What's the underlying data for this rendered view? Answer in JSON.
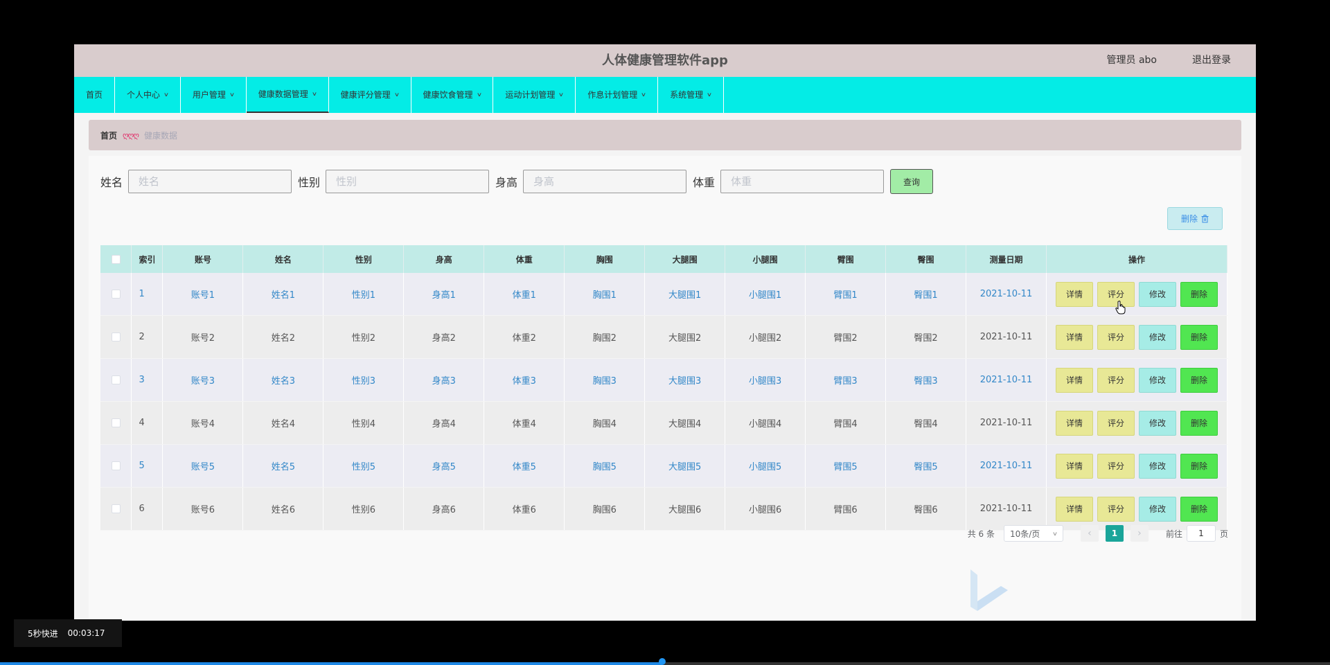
{
  "header": {
    "title": "人体健康管理软件app",
    "admin": "管理员 abo",
    "logout": "退出登录"
  },
  "nav": [
    {
      "label": "首页",
      "has_dropdown": false,
      "active": false
    },
    {
      "label": "个人中心",
      "has_dropdown": true,
      "active": false
    },
    {
      "label": "用户管理",
      "has_dropdown": true,
      "active": false
    },
    {
      "label": "健康数据管理",
      "has_dropdown": true,
      "active": true
    },
    {
      "label": "健康评分管理",
      "has_dropdown": true,
      "active": false
    },
    {
      "label": "健康饮食管理",
      "has_dropdown": true,
      "active": false
    },
    {
      "label": "运动计划管理",
      "has_dropdown": true,
      "active": false
    },
    {
      "label": "作息计划管理",
      "has_dropdown": true,
      "active": false
    },
    {
      "label": "系统管理",
      "has_dropdown": true,
      "active": false
    }
  ],
  "breadcrumb": {
    "home": "首页",
    "separator": "ღღღ",
    "current": "健康数据"
  },
  "search": {
    "name_label": "姓名",
    "name_placeholder": "姓名",
    "name_value": "",
    "gender_label": "性别",
    "gender_placeholder": "性别",
    "gender_value": "",
    "height_label": "身高",
    "height_placeholder": "身高",
    "height_value": "",
    "weight_label": "体重",
    "weight_placeholder": "体重",
    "weight_value": "",
    "query_button": "查询"
  },
  "bulk_delete": {
    "label": "删除",
    "icon": "trash-icon"
  },
  "table": {
    "columns": [
      "索引",
      "账号",
      "姓名",
      "性别",
      "身高",
      "体重",
      "胸围",
      "大腿围",
      "小腿围",
      "臂围",
      "臀围",
      "测量日期",
      "操作"
    ],
    "rows": [
      {
        "index": "1",
        "cells": [
          "账号1",
          "姓名1",
          "性别1",
          "身高1",
          "体重1",
          "胸围1",
          "大腿围1",
          "小腿围1",
          "臂围1",
          "臀围1",
          "2021-10-11"
        ]
      },
      {
        "index": "2",
        "cells": [
          "账号2",
          "姓名2",
          "性别2",
          "身高2",
          "体重2",
          "胸围2",
          "大腿围2",
          "小腿围2",
          "臂围2",
          "臀围2",
          "2021-10-11"
        ]
      },
      {
        "index": "3",
        "cells": [
          "账号3",
          "姓名3",
          "性别3",
          "身高3",
          "体重3",
          "胸围3",
          "大腿围3",
          "小腿围3",
          "臂围3",
          "臀围3",
          "2021-10-11"
        ]
      },
      {
        "index": "4",
        "cells": [
          "账号4",
          "姓名4",
          "性别4",
          "身高4",
          "体重4",
          "胸围4",
          "大腿围4",
          "小腿围4",
          "臂围4",
          "臀围4",
          "2021-10-11"
        ]
      },
      {
        "index": "5",
        "cells": [
          "账号5",
          "姓名5",
          "性别5",
          "身高5",
          "体重5",
          "胸围5",
          "大腿围5",
          "小腿围5",
          "臂围5",
          "臀围5",
          "2021-10-11"
        ]
      },
      {
        "index": "6",
        "cells": [
          "账号6",
          "姓名6",
          "性别6",
          "身高6",
          "体重6",
          "胸围6",
          "大腿围6",
          "小腿围6",
          "臂围6",
          "臀围6",
          "2021-10-11"
        ]
      }
    ],
    "actions": {
      "detail": "详情",
      "score": "评分",
      "edit": "修改",
      "delete": "删除"
    }
  },
  "pagination": {
    "total": "共 6 条",
    "page_size": "10条/页",
    "current_page": "1",
    "goto_label": "前往",
    "goto_value": "1",
    "page_suffix": "页"
  },
  "video": {
    "speed_label": "5秒快进",
    "time": "00:03:17",
    "progress": 0.498
  },
  "colors": {
    "header_bg": "#d9cccd",
    "nav_bg": "#04ece6",
    "table_header_bg": "#c1ebe7",
    "link_blue": "#3287c8",
    "page_active": "#1aa59a"
  }
}
